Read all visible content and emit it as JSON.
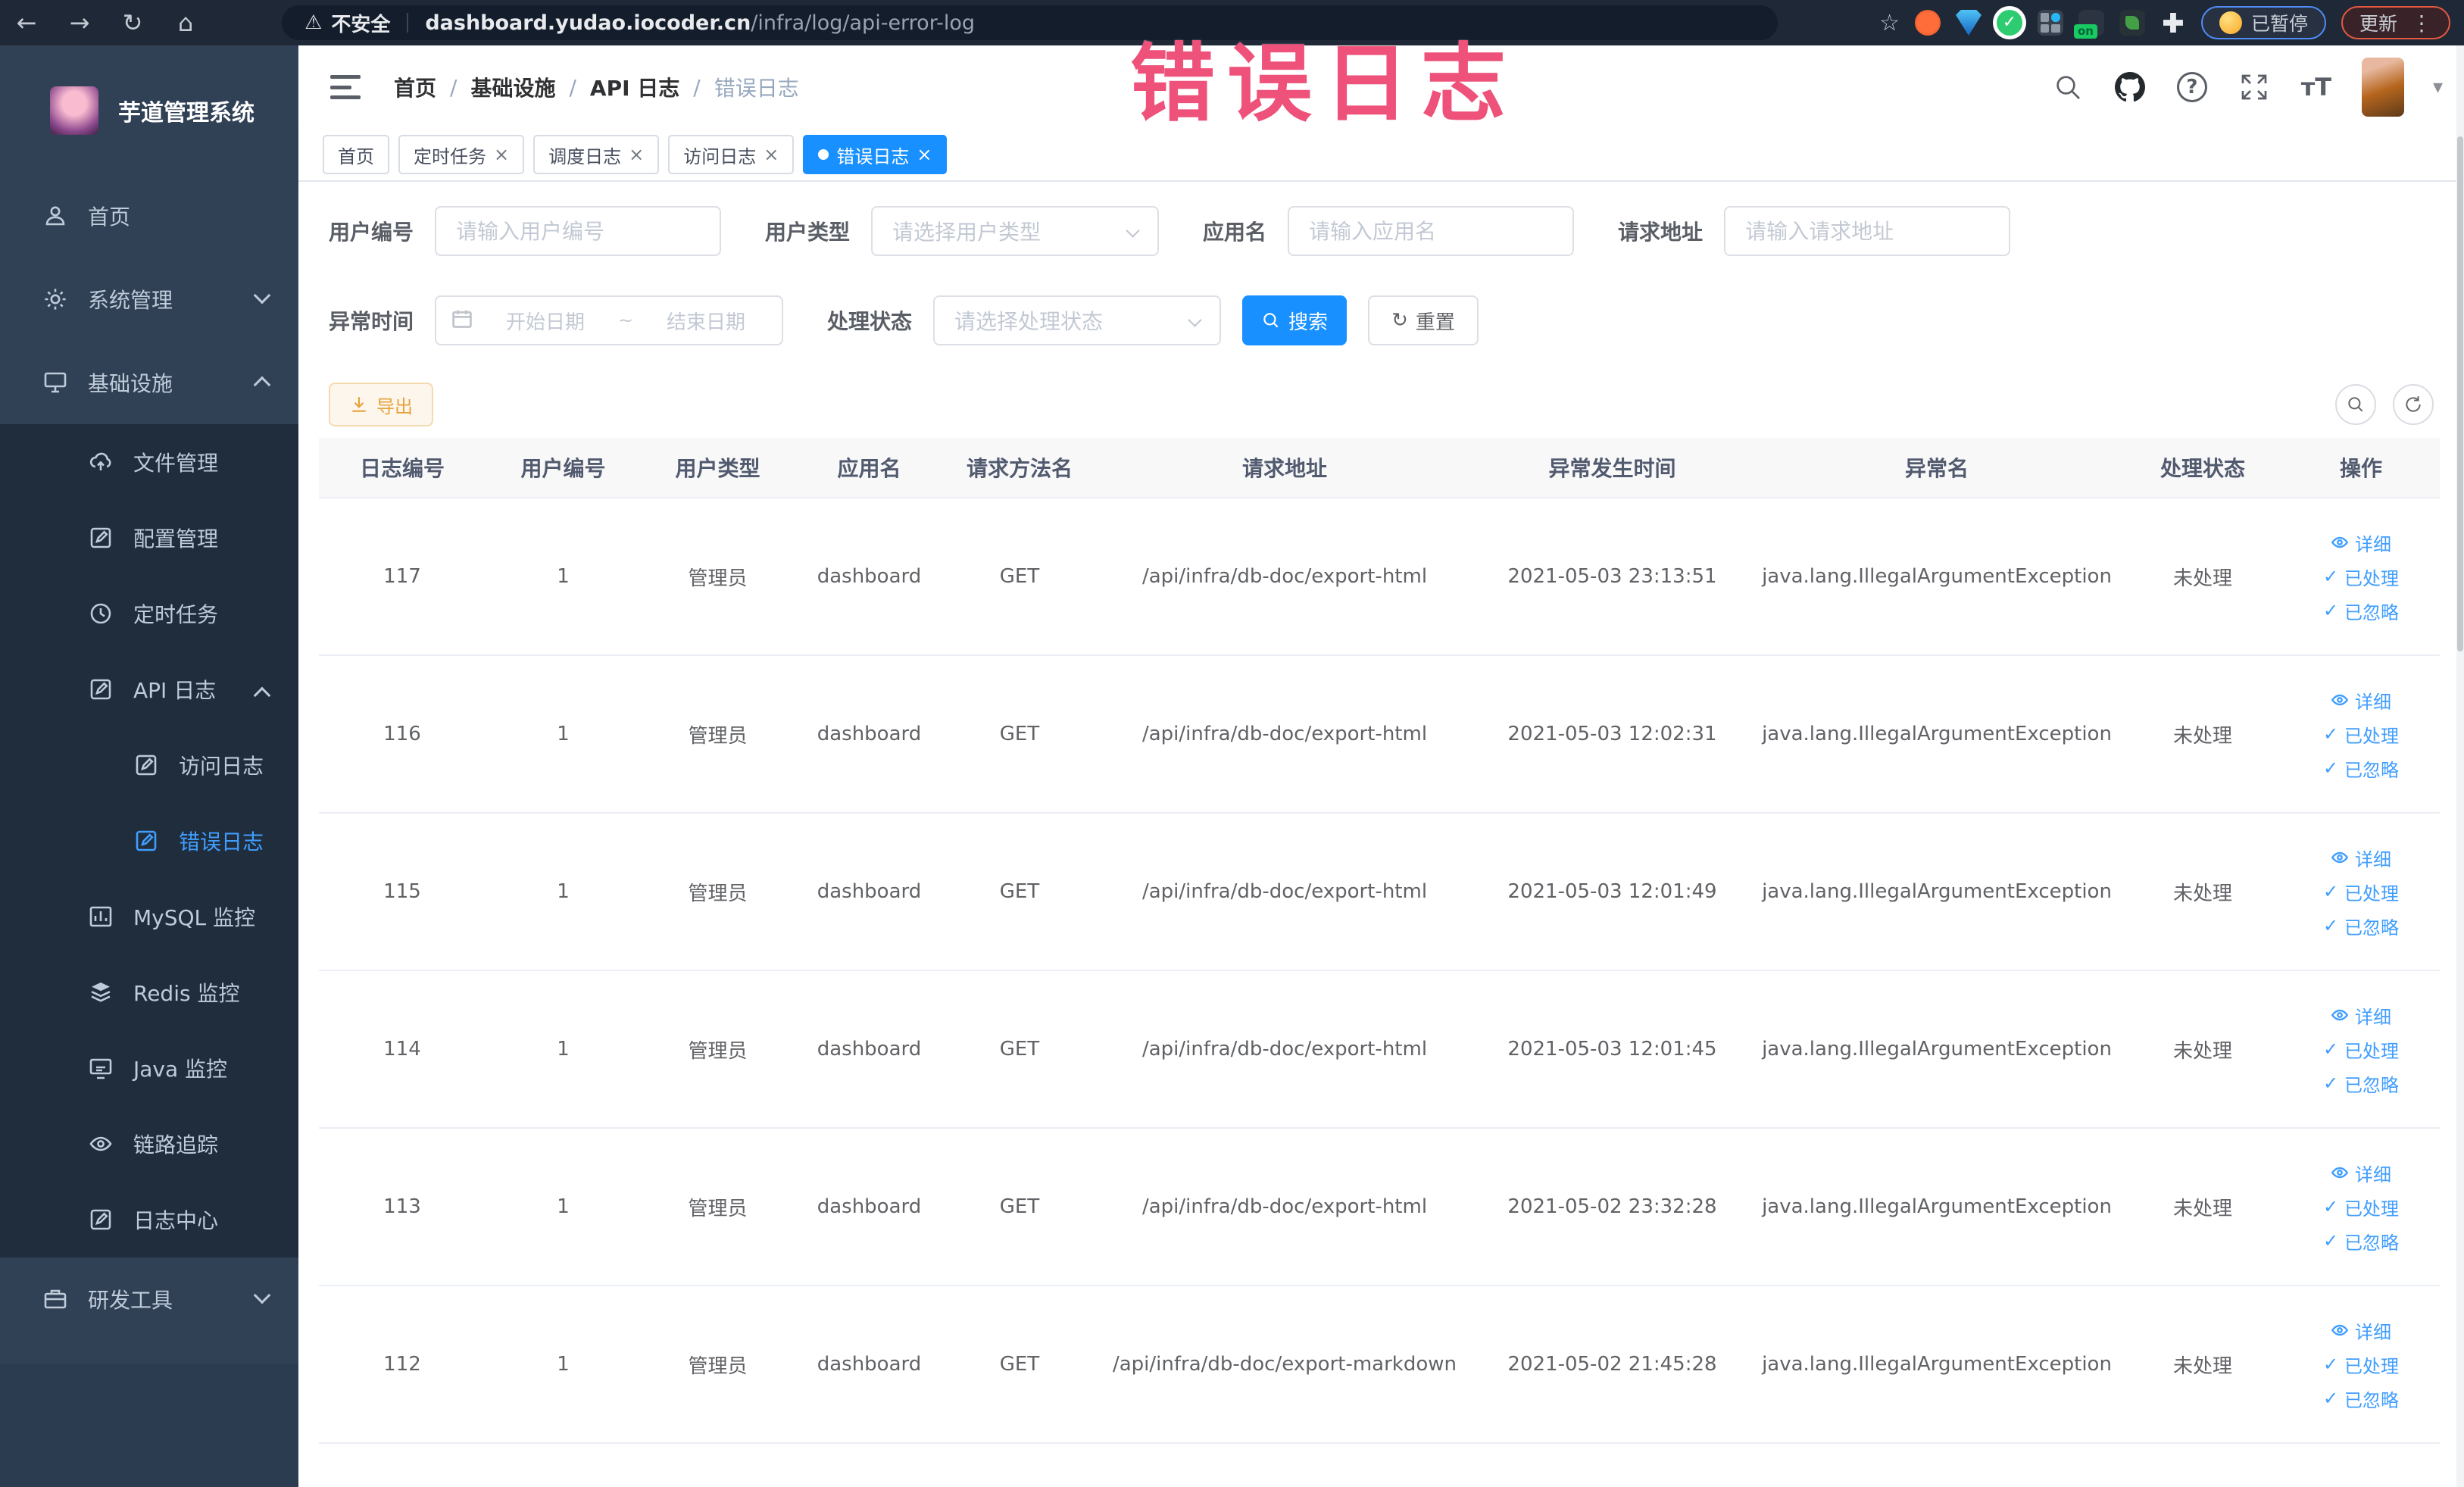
{
  "icons": {
    "back": "←",
    "forward": "→",
    "reload": "↻",
    "home": "⌂",
    "warning": "⚠",
    "star": "☆",
    "check": "✓",
    "close": "×",
    "kebab": "⋮",
    "caret": "▾",
    "refresh": "↻",
    "question": "?",
    "text_size": "тT"
  },
  "browser": {
    "security_label": "不安全",
    "url_domain": "dashboard.yudao.iocoder.cn",
    "url_path": "/infra/log/api-error-log",
    "git_badge": "on",
    "extension_check": "✓",
    "profile_badge": "已暂停",
    "update_button": "更新"
  },
  "overlay_title": "错误日志",
  "sidebar": {
    "logo_title": "芋道管理系统",
    "items": [
      {
        "label": "首页"
      },
      {
        "label": "系统管理"
      },
      {
        "label": "基础设施"
      },
      {
        "label": "文件管理"
      },
      {
        "label": "配置管理"
      },
      {
        "label": "定时任务"
      },
      {
        "label": "API 日志"
      },
      {
        "label": "访问日志"
      },
      {
        "label": "错误日志"
      },
      {
        "label": "MySQL 监控"
      },
      {
        "label": "Redis 监控"
      },
      {
        "label": "Java 监控"
      },
      {
        "label": "链路追踪"
      },
      {
        "label": "日志中心"
      },
      {
        "label": "研发工具"
      }
    ]
  },
  "header": {
    "breadcrumb": [
      "首页",
      "基础设施",
      "API 日志",
      "错误日志"
    ],
    "breadcrumb_separator": "/"
  },
  "tabs": [
    {
      "label": "首页"
    },
    {
      "label": "定时任务"
    },
    {
      "label": "调度日志"
    },
    {
      "label": "访问日志"
    },
    {
      "label": "错误日志"
    }
  ],
  "filters": {
    "user_id": {
      "label": "用户编号",
      "placeholder": "请输入用户编号"
    },
    "user_type": {
      "label": "用户类型",
      "placeholder": "请选择用户类型"
    },
    "app_name": {
      "label": "应用名",
      "placeholder": "请输入应用名"
    },
    "request_url": {
      "label": "请求地址",
      "placeholder": "请输入请求地址"
    },
    "exception_time": {
      "label": "异常时间",
      "start_placeholder": "开始日期",
      "separator": "~",
      "end_placeholder": "结束日期"
    },
    "process_status": {
      "label": "处理状态",
      "placeholder": "请选择处理状态"
    },
    "search_button": "搜索",
    "reset_button": "重置"
  },
  "toolbar": {
    "export_button": "导出"
  },
  "table": {
    "headers": [
      "日志编号",
      "用户编号",
      "用户类型",
      "应用名",
      "请求方法名",
      "请求地址",
      "异常发生时间",
      "异常名",
      "处理状态",
      "操作"
    ],
    "action_labels": {
      "detail": "详细",
      "processed": "已处理",
      "ignored": "已忽略"
    },
    "rows": [
      {
        "id": "117",
        "user_id": "1",
        "user_type": "管理员",
        "app": "dashboard",
        "method": "GET",
        "url": "/api/infra/db-doc/export-html",
        "time": "2021-05-03 23:13:51",
        "exception": "java.lang.IllegalArgumentException",
        "status": "未处理"
      },
      {
        "id": "116",
        "user_id": "1",
        "user_type": "管理员",
        "app": "dashboard",
        "method": "GET",
        "url": "/api/infra/db-doc/export-html",
        "time": "2021-05-03 12:02:31",
        "exception": "java.lang.IllegalArgumentException",
        "status": "未处理"
      },
      {
        "id": "115",
        "user_id": "1",
        "user_type": "管理员",
        "app": "dashboard",
        "method": "GET",
        "url": "/api/infra/db-doc/export-html",
        "time": "2021-05-03 12:01:49",
        "exception": "java.lang.IllegalArgumentException",
        "status": "未处理"
      },
      {
        "id": "114",
        "user_id": "1",
        "user_type": "管理员",
        "app": "dashboard",
        "method": "GET",
        "url": "/api/infra/db-doc/export-html",
        "time": "2021-05-03 12:01:45",
        "exception": "java.lang.IllegalArgumentException",
        "status": "未处理"
      },
      {
        "id": "113",
        "user_id": "1",
        "user_type": "管理员",
        "app": "dashboard",
        "method": "GET",
        "url": "/api/infra/db-doc/export-html",
        "time": "2021-05-02 23:32:28",
        "exception": "java.lang.IllegalArgumentException",
        "status": "未处理"
      },
      {
        "id": "112",
        "user_id": "1",
        "user_type": "管理员",
        "app": "dashboard",
        "method": "GET",
        "url": "/api/infra/db-doc/export-markdown",
        "time": "2021-05-02 21:45:28",
        "exception": "java.lang.IllegalArgumentException",
        "status": "未处理"
      }
    ]
  }
}
